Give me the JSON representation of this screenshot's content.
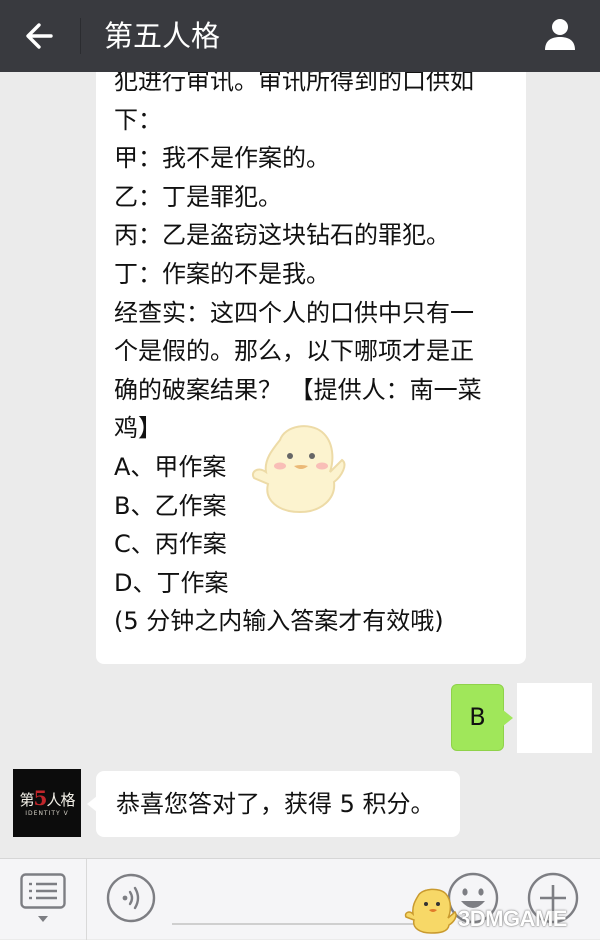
{
  "header": {
    "title": "第五人格",
    "back_icon": "arrow-left-icon",
    "profile_icon": "person-icon"
  },
  "messages": {
    "question_lines": [
      "犯进行审讯。审讯所得到的口供如",
      "下：",
      "甲：我不是作案的。",
      "乙：丁是罪犯。",
      "丙：乙是盗窃这块钻石的罪犯。",
      "丁：作案的不是我。",
      "经查实：这四个人的口供中只有一",
      "个是假的。那么，以下哪项才是正",
      "确的破案结果？ 【提供人：南一菜",
      "鸡】",
      "A、甲作案",
      "B、乙作案",
      "C、丙作案",
      "D、丁作案",
      "(5 分钟之内输入答案才有效哦)"
    ],
    "user_answer": "B",
    "reply": "恭喜您答对了，获得 5 积分。",
    "bot_avatar": {
      "logo_left": "第",
      "logo_number": "5",
      "logo_right": "人格",
      "logo_subtitle": "IDENTITY V"
    }
  },
  "bottom_bar": {
    "menu_icon": "menu-list-icon",
    "voice_icon": "voice-icon",
    "emoji_icon": "emoji-icon",
    "plus_icon": "plus-icon"
  },
  "watermark": {
    "text": "3DMGAME"
  },
  "colors": {
    "header_bg": "#393a3f",
    "chat_bg": "#ebebeb",
    "user_bubble": "#a0e75a",
    "bot_bubble": "#ffffff"
  }
}
